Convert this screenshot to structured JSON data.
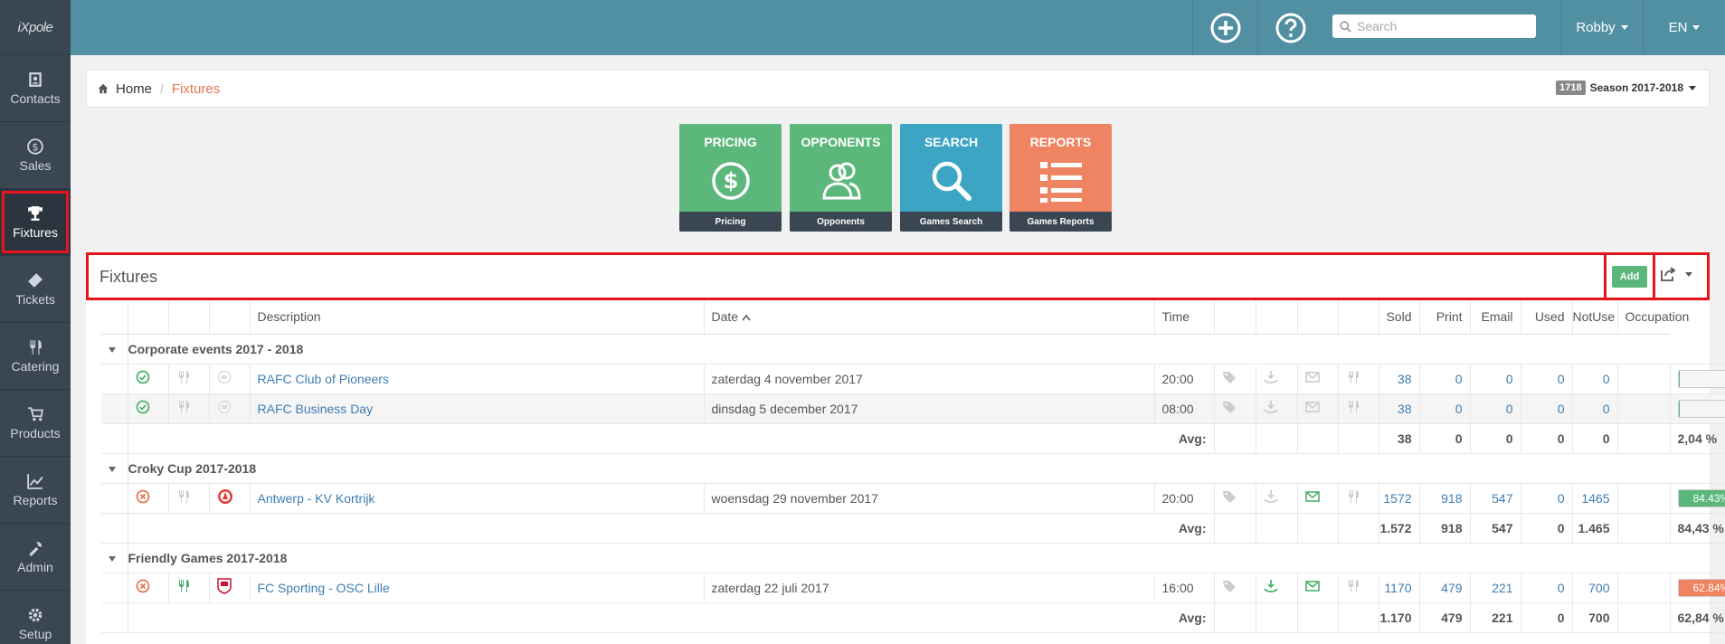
{
  "sidebar": {
    "logo": "iXpole",
    "items": [
      {
        "label": "Contacts",
        "icon": "contacts-icon"
      },
      {
        "label": "Sales",
        "icon": "dollar-icon"
      },
      {
        "label": "Fixtures",
        "icon": "trophy-icon",
        "active": true
      },
      {
        "label": "Tickets",
        "icon": "ticket-icon"
      },
      {
        "label": "Catering",
        "icon": "cutlery-icon"
      },
      {
        "label": "Products",
        "icon": "cart-icon"
      },
      {
        "label": "Reports",
        "icon": "chart-icon"
      },
      {
        "label": "Admin",
        "icon": "tools-icon"
      },
      {
        "label": "Setup",
        "icon": "cog-icon"
      }
    ]
  },
  "topbar": {
    "search_placeholder": "Search",
    "user": "Robby",
    "lang": "EN"
  },
  "breadcrumb": {
    "home": "Home",
    "current": "Fixtures"
  },
  "season": {
    "badge": "1718",
    "label": "Season 2017-2018"
  },
  "tiles": [
    {
      "title": "PRICING",
      "footer": "Pricing",
      "color": "#5cb77b",
      "icon": "dollar-circle-icon"
    },
    {
      "title": "OPPONENTS",
      "footer": "Opponents",
      "color": "#5cb77b",
      "icon": "users-icon"
    },
    {
      "title": "SEARCH",
      "footer": "Games Search",
      "color": "#3da5c4",
      "icon": "search-icon"
    },
    {
      "title": "REPORTS",
      "footer": "Games Reports",
      "color": "#ef8462",
      "icon": "list-icon"
    }
  ],
  "panel": {
    "title": "Fixtures",
    "add_label": "Add"
  },
  "table": {
    "headers": {
      "description": "Description",
      "date": "Date",
      "time": "Time",
      "sold": "Sold",
      "print": "Print",
      "email": "Email",
      "used": "Used",
      "notuse": "NotUse",
      "occupation": "Occupation"
    },
    "avg_label": "Avg:",
    "groups": [
      {
        "name": "Corporate events 2017 - 2018",
        "rows": [
          {
            "status": "ok",
            "desc": "RAFC Club of Pioneers",
            "date": "zaterdag 4 november 2017",
            "time": "20:00",
            "sold": "38",
            "print": "0",
            "email": "0",
            "used": "0",
            "notuse": "0",
            "occ": 2.04,
            "occ_text": "",
            "color": "#5cb77b"
          },
          {
            "status": "ok",
            "desc": "RAFC Business Day",
            "date": "dinsdag 5 december 2017",
            "time": "08:00",
            "sold": "38",
            "print": "0",
            "email": "0",
            "used": "0",
            "notuse": "0",
            "occ": 2.04,
            "occ_text": "",
            "color": "#5cb77b"
          }
        ],
        "avg": {
          "sold": "38",
          "print": "0",
          "email": "0",
          "used": "0",
          "notuse": "0",
          "occ": "2,04 %"
        }
      },
      {
        "name": "Croky Cup 2017-2018",
        "rows": [
          {
            "status": "x",
            "desc": "Antwerp - KV Kortrijk",
            "date": "woensdag 29 november 2017",
            "time": "20:00",
            "sold": "1572",
            "print": "918",
            "email": "547",
            "used": "0",
            "notuse": "1465",
            "occ": 84.43,
            "occ_text": "84.43%",
            "color": "#5cb77b"
          }
        ],
        "avg": {
          "sold": "1.572",
          "print": "918",
          "email": "547",
          "used": "0",
          "notuse": "1.465",
          "occ": "84,43 %"
        }
      },
      {
        "name": "Friendly Games 2017-2018",
        "rows": [
          {
            "status": "x",
            "desc": "FC Sporting - OSC Lille",
            "date": "zaterdag 22 juli 2017",
            "time": "16:00",
            "sold": "1170",
            "print": "479",
            "email": "221",
            "used": "0",
            "notuse": "700",
            "occ": 62.84,
            "occ_text": "62.84%",
            "color": "#ef8462"
          }
        ],
        "avg": {
          "sold": "1.170",
          "print": "479",
          "email": "221",
          "used": "0",
          "notuse": "700",
          "occ": "62,84 %"
        }
      }
    ]
  }
}
